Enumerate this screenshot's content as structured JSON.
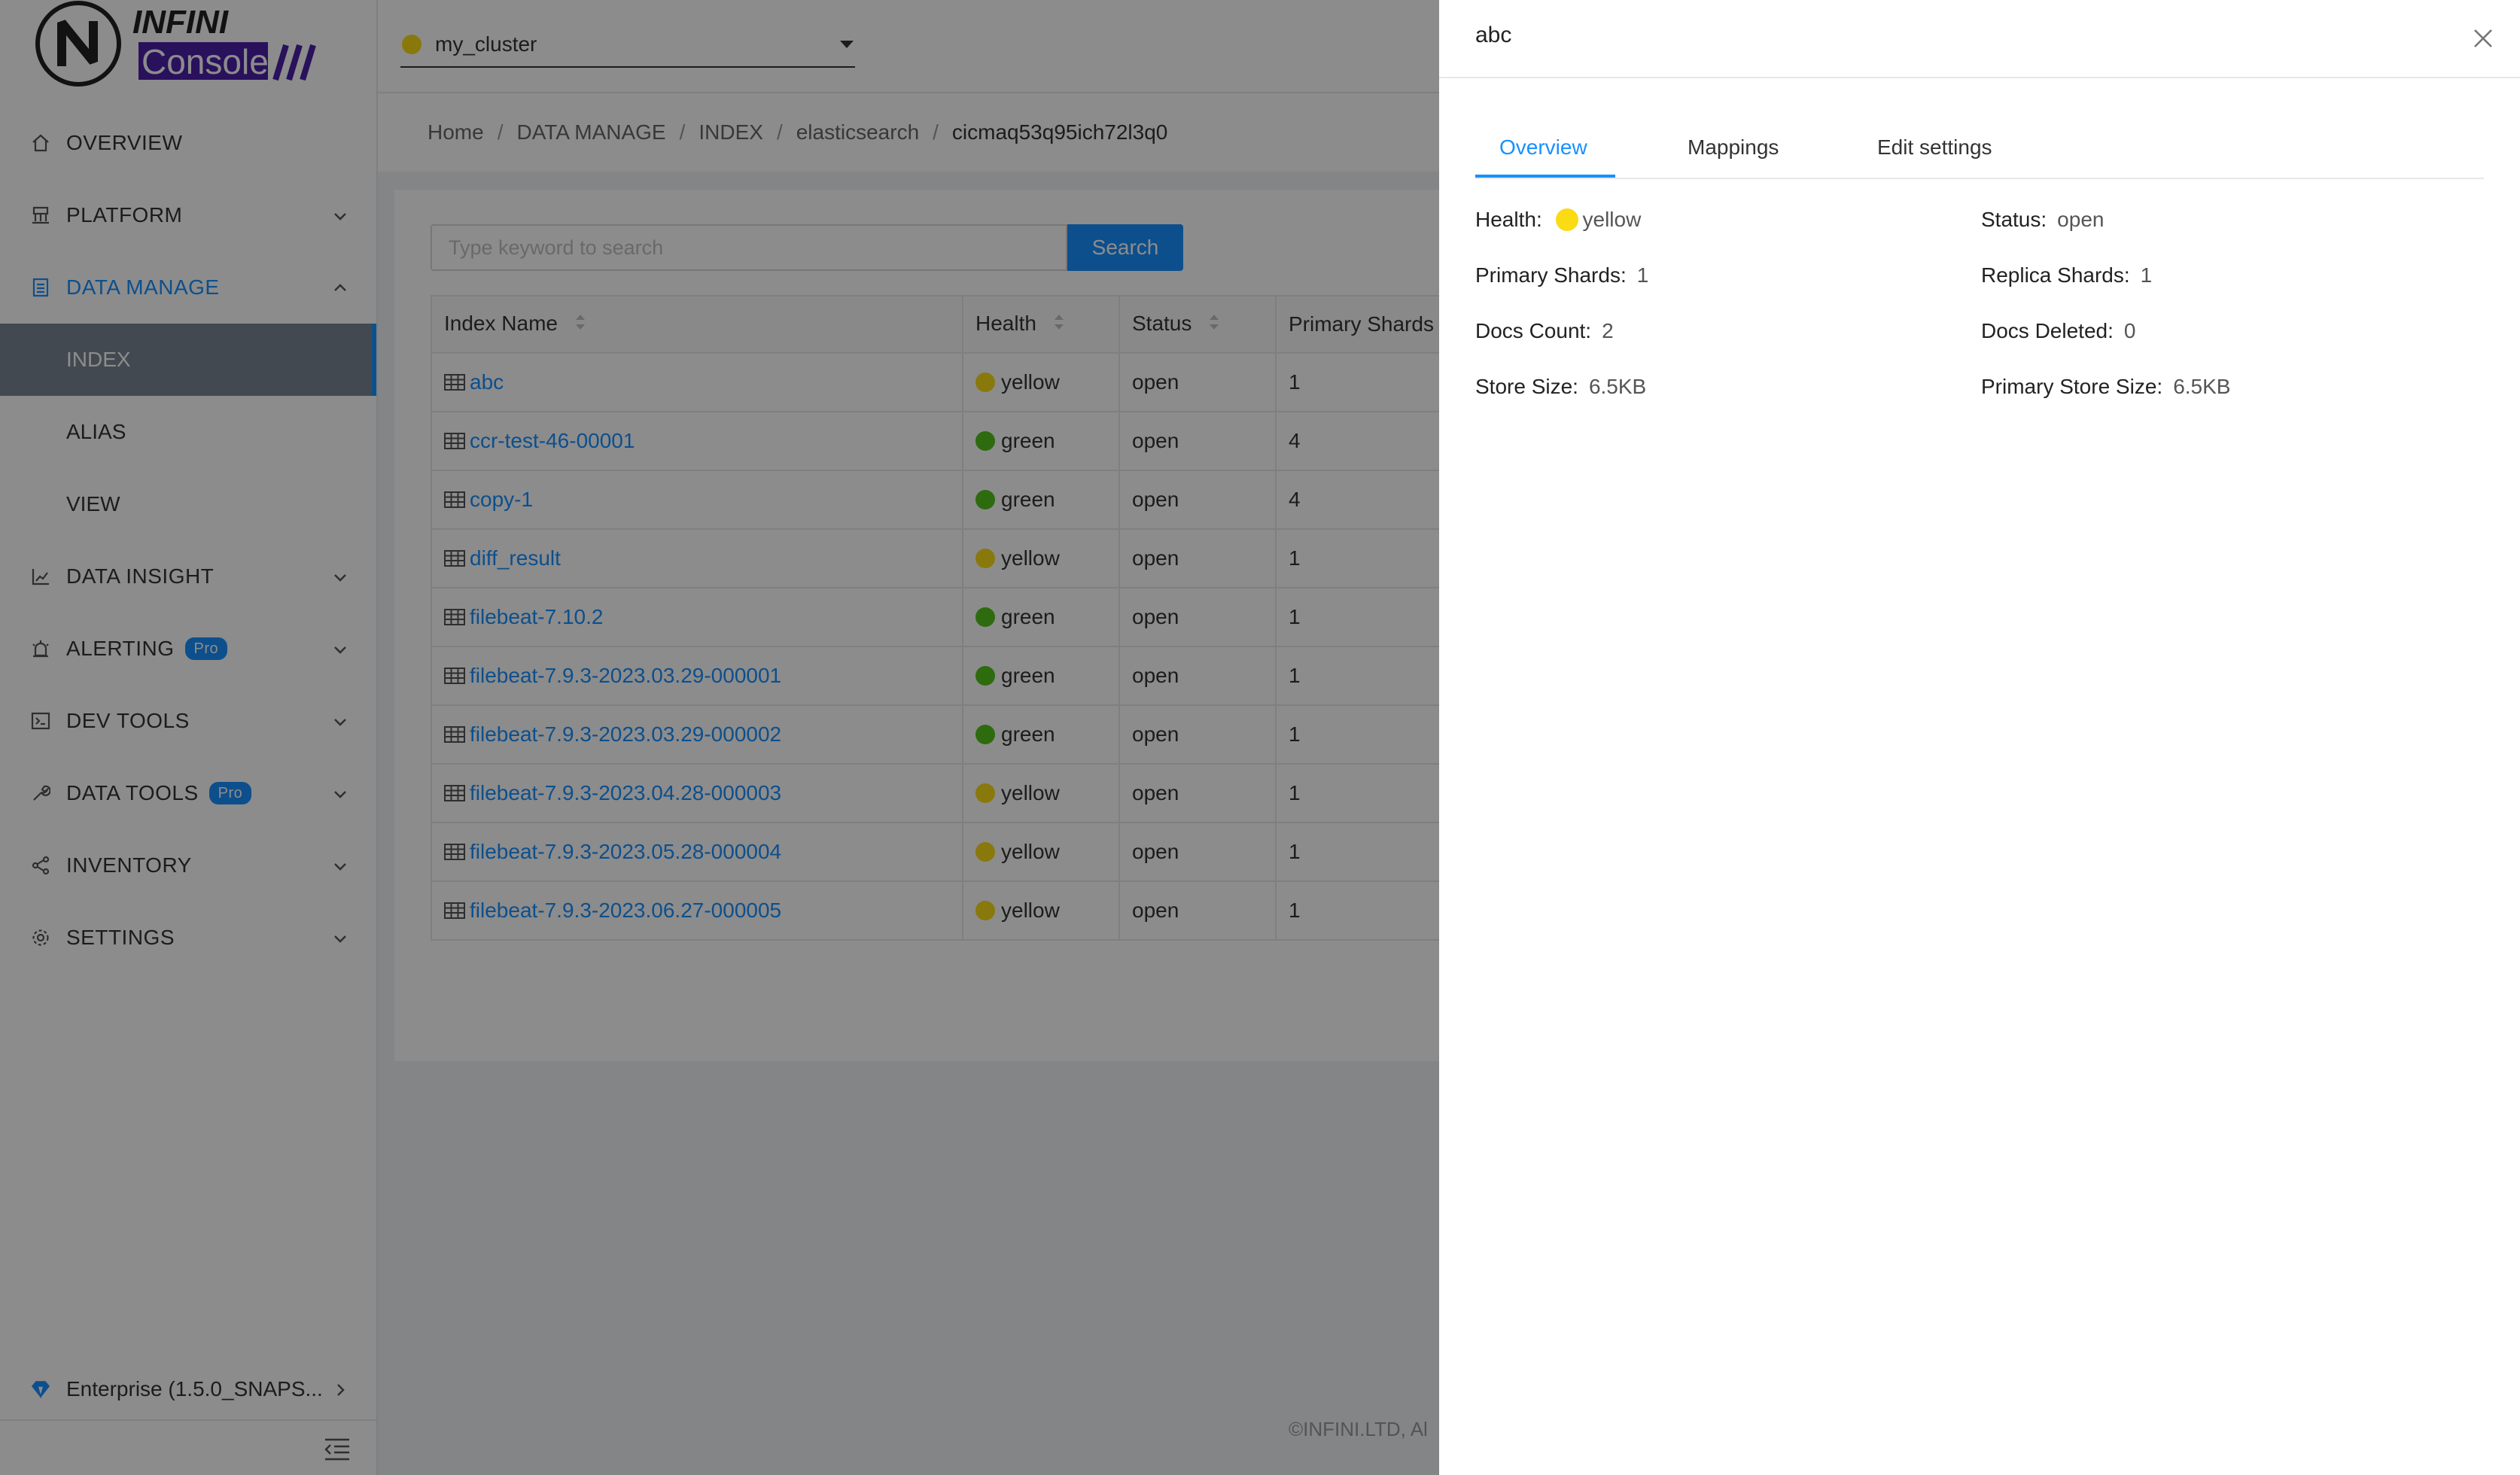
{
  "app": {
    "logo_text_top": "INFINI",
    "logo_text_bottom": "Console"
  },
  "colors": {
    "primary": "#1890ff",
    "health_yellow": "#fadb14",
    "health_green": "#52c41a"
  },
  "header": {
    "cluster": {
      "name": "my_cluster",
      "health": "yellow"
    }
  },
  "sidebar": {
    "menu": [
      {
        "label": "OVERVIEW",
        "icon": "home-icon"
      },
      {
        "label": "PLATFORM",
        "icon": "platform-icon"
      },
      {
        "label": "DATA MANAGE",
        "icon": "data-manage-icon"
      },
      {
        "label": "DATA INSIGHT",
        "icon": "chart-icon"
      },
      {
        "label": "ALERTING",
        "icon": "alarm-icon",
        "badge": "Pro"
      },
      {
        "label": "DEV TOOLS",
        "icon": "terminal-icon"
      },
      {
        "label": "DATA TOOLS",
        "icon": "tool-icon",
        "badge": "Pro"
      },
      {
        "label": "INVENTORY",
        "icon": "share-icon"
      },
      {
        "label": "SETTINGS",
        "icon": "gear-icon"
      }
    ],
    "submenu": [
      {
        "label": "INDEX"
      },
      {
        "label": "ALIAS"
      },
      {
        "label": "VIEW"
      }
    ],
    "footer": {
      "edition": "Enterprise (1.5.0_SNAPS...",
      "icon": "diamond-icon"
    }
  },
  "breadcrumb": {
    "items": [
      "Home",
      "DATA MANAGE",
      "INDEX",
      "elasticsearch",
      "cicmaq53q95ich72l3q0"
    ]
  },
  "search": {
    "placeholder": "Type keyword to search",
    "button": "Search"
  },
  "table": {
    "columns": [
      "Index Name",
      "Health",
      "Status",
      "Primary Shards"
    ],
    "rows": [
      {
        "name": "abc",
        "health": "yellow",
        "status": "open",
        "primary": "1"
      },
      {
        "name": "ccr-test-46-00001",
        "health": "green",
        "status": "open",
        "primary": "4"
      },
      {
        "name": "copy-1",
        "health": "green",
        "status": "open",
        "primary": "4"
      },
      {
        "name": "diff_result",
        "health": "yellow",
        "status": "open",
        "primary": "1"
      },
      {
        "name": "filebeat-7.10.2",
        "health": "green",
        "status": "open",
        "primary": "1"
      },
      {
        "name": "filebeat-7.9.3-2023.03.29-000001",
        "health": "green",
        "status": "open",
        "primary": "1"
      },
      {
        "name": "filebeat-7.9.3-2023.03.29-000002",
        "health": "green",
        "status": "open",
        "primary": "1"
      },
      {
        "name": "filebeat-7.9.3-2023.04.28-000003",
        "health": "yellow",
        "status": "open",
        "primary": "1"
      },
      {
        "name": "filebeat-7.9.3-2023.05.28-000004",
        "health": "yellow",
        "status": "open",
        "primary": "1"
      },
      {
        "name": "filebeat-7.9.3-2023.06.27-000005",
        "health": "yellow",
        "status": "open",
        "primary": "1"
      }
    ]
  },
  "footer": {
    "copyright": "©INFINI.LTD, Al"
  },
  "drawer": {
    "title": "abc",
    "tabs": [
      "Overview",
      "Mappings",
      "Edit settings"
    ],
    "active_tab": "Overview",
    "fields": {
      "health": {
        "label": "Health",
        "value": "yellow"
      },
      "status": {
        "label": "Status",
        "value": "open"
      },
      "primary_shards": {
        "label": "Primary Shards",
        "value": "1"
      },
      "replica_shards": {
        "label": "Replica Shards",
        "value": "1"
      },
      "docs_count": {
        "label": "Docs Count",
        "value": "2"
      },
      "docs_deleted": {
        "label": "Docs Deleted",
        "value": "0"
      },
      "store_size": {
        "label": "Store Size",
        "value": "6.5KB"
      },
      "primary_store_size": {
        "label": "Primary Store Size",
        "value": "6.5KB"
      }
    }
  }
}
